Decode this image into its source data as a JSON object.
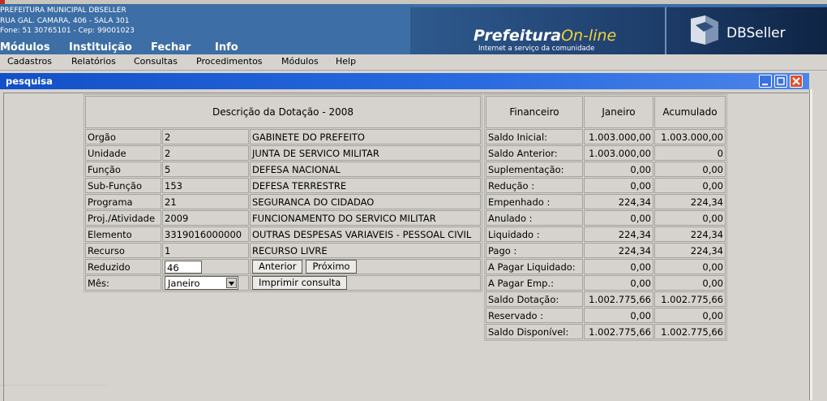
{
  "header": {
    "address_lines": [
      "PREFEITURA MUNICIPAL DBSELLER",
      "RUA GAL. CAMARA, 406 - SALA 301",
      "Fone: 51 30765101  -  Cep: 99001023"
    ],
    "brand_title": "Prefeitura",
    "brand_online": "On-line",
    "brand_tagline": "Internet a serviço da comunidade",
    "vendor": "DBSeller"
  },
  "main_menu": [
    "Módulos",
    "Instituição",
    "Fechar",
    "Info"
  ],
  "menubar": [
    "Cadastros",
    "Relatórios",
    "Consultas",
    "Procedimentos",
    "Módulos",
    "Help"
  ],
  "window": {
    "title": "pesquisa"
  },
  "dotacao": {
    "title": "Descrição da Dotação - 2008",
    "rows": [
      {
        "label": "Orgão",
        "code": "2",
        "desc": "GABINETE DO PREFEITO"
      },
      {
        "label": "Unidade",
        "code": "2",
        "desc": "JUNTA DE SERVICO MILITAR"
      },
      {
        "label": "Função",
        "code": "5",
        "desc": "DEFESA NACIONAL"
      },
      {
        "label": "Sub-Função",
        "code": "153",
        "desc": "DEFESA TERRESTRE"
      },
      {
        "label": "Programa",
        "code": "21",
        "desc": "SEGURANCA DO CIDADAO"
      },
      {
        "label": "Proj./Atividade",
        "code": "2009",
        "desc": "FUNCIONAMENTO DO SERVICO MILITAR"
      },
      {
        "label": "Elemento",
        "code": "3319016000000",
        "desc": "OUTRAS DESPESAS VARIAVEIS - PESSOAL CIVIL"
      },
      {
        "label": "Recurso",
        "code": "1",
        "desc": "RECURSO LIVRE"
      }
    ],
    "reduzido_label": "Reduzido",
    "reduzido_value": "46",
    "anterior_label": "Anterior",
    "proximo_label": "Próximo",
    "mes_label": "Mês:",
    "mes_value": "Janeiro",
    "imprimir_label": "Imprimir consulta"
  },
  "financeiro": {
    "headers": [
      "Financeiro",
      "Janeiro",
      "Acumulado"
    ],
    "rows": [
      {
        "label": "Saldo Inicial:",
        "month": "1.003.000,00",
        "acc": "1.003.000,00"
      },
      {
        "label": "Saldo Anterior:",
        "month": "1.003.000,00",
        "acc": "0"
      },
      {
        "label": "Suplementação:",
        "month": "0,00",
        "acc": "0,00"
      },
      {
        "label": "Redução :",
        "month": "0,00",
        "acc": "0,00"
      },
      {
        "label": "Empenhado :",
        "month": "224,34",
        "acc": "224,34"
      },
      {
        "label": "Anulado :",
        "month": "0,00",
        "acc": "0,00"
      },
      {
        "label": "Liquidado :",
        "month": "224,34",
        "acc": "224,34"
      },
      {
        "label": "Pago :",
        "month": "224,34",
        "acc": "224,34"
      },
      {
        "label": "A Pagar Liquidado:",
        "month": "0,00",
        "acc": "0,00"
      },
      {
        "label": "A Pagar Emp.:",
        "month": "0,00",
        "acc": "0,00"
      },
      {
        "label": "Saldo Dotação:",
        "month": "1.002.775,66",
        "acc": "1.002.775,66"
      },
      {
        "label": "Reservado :",
        "month": "0,00",
        "acc": "0,00"
      },
      {
        "label": "Saldo Disponível:",
        "month": "1.002.775,66",
        "acc": "1.002.775,66"
      }
    ]
  }
}
